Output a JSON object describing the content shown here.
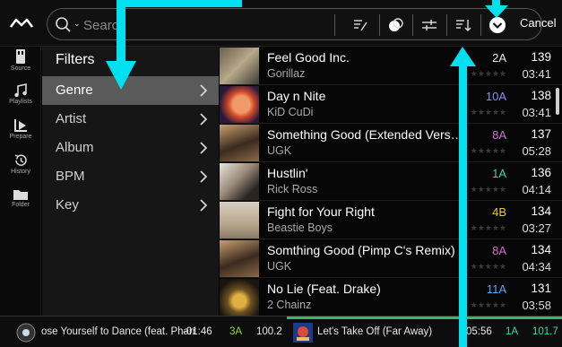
{
  "search": {
    "placeholder": "Search"
  },
  "toolbar": {
    "cancel_label": "Cancel"
  },
  "rail": [
    {
      "label": "Source",
      "icon": "source-icon"
    },
    {
      "label": "Playlists",
      "icon": "playlists-icon"
    },
    {
      "label": "Prepare",
      "icon": "prepare-icon"
    },
    {
      "label": "History",
      "icon": "history-icon"
    },
    {
      "label": "Folder",
      "icon": "folder-icon"
    }
  ],
  "filters": {
    "title": "Filters",
    "items": [
      {
        "label": "Genre",
        "active": true
      },
      {
        "label": "Artist",
        "active": false
      },
      {
        "label": "Album",
        "active": false
      },
      {
        "label": "BPM",
        "active": false
      },
      {
        "label": "Key",
        "active": false
      }
    ]
  },
  "tracks": [
    {
      "title": "Feel Good Inc.",
      "artist": "Gorillaz",
      "key": "2A",
      "key_color": "#e8e8e8",
      "bpm": "139",
      "length": "03:41",
      "rating": "★★★★★"
    },
    {
      "title": "Day n Nite",
      "artist": "KiD CuDi",
      "key": "10A",
      "key_color": "#8e8ef0",
      "bpm": "138",
      "length": "03:41",
      "rating": "★★★★★"
    },
    {
      "title": "Something Good (Extended Vers…",
      "artist": "UGK",
      "key": "8A",
      "key_color": "#d36ed3",
      "bpm": "137",
      "length": "05:28",
      "rating": "★★★★★"
    },
    {
      "title": "Hustlin'",
      "artist": "Rick Ross",
      "key": "1A",
      "key_color": "#37d6b4",
      "bpm": "136",
      "length": "04:14",
      "rating": "★★★★★"
    },
    {
      "title": "Fight for Your Right",
      "artist": "Beastie Boys",
      "key": "4B",
      "key_color": "#f0c63a",
      "bpm": "134",
      "length": "03:27",
      "rating": "★★★★★"
    },
    {
      "title": "Somthing Good (Pimp C's Remix)",
      "artist": "UGK",
      "key": "8A",
      "key_color": "#d36ed3",
      "bpm": "134",
      "length": "04:34",
      "rating": "★★★★★"
    },
    {
      "title": "No Lie (Feat. Drake)",
      "artist": "2 Chainz",
      "key": "11A",
      "key_color": "#5aa8f0",
      "bpm": "131",
      "length": "03:58",
      "rating": "★★★★★"
    }
  ],
  "decks": {
    "left": {
      "title": "ose Yourself to Dance (feat. Pharr",
      "time": "-01:46",
      "key": "3A",
      "key_color": "#8fd64a",
      "bpm": "100.2"
    },
    "right": {
      "title": "Let's Take Off (Far Away)",
      "time": "05:56",
      "key": "1A",
      "key_color": "#37d6b4",
      "bpm": "101.7"
    }
  },
  "colors": {
    "accent_cyan": "#00e0f0",
    "active_row": "#5a5a5a"
  }
}
